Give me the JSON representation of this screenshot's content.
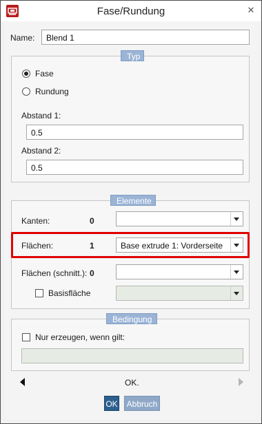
{
  "window": {
    "title": "Fase/Rundung",
    "close_glyph": "✕",
    "app_icon": "fillet-tool-icon",
    "accent_color": "#b71c1c"
  },
  "name_field": {
    "label": "Name:",
    "value": "Blend 1"
  },
  "typ_group": {
    "legend": "Typ",
    "options": [
      {
        "label": "Fase",
        "selected": true
      },
      {
        "label": "Rundung",
        "selected": false
      }
    ],
    "abstand1": {
      "label": "Abstand 1:",
      "value": "0.5"
    },
    "abstand2": {
      "label": "Abstand 2:",
      "value": "0.5"
    }
  },
  "elemente_group": {
    "legend": "Elemente",
    "kanten": {
      "label": "Kanten:",
      "count": "0",
      "value": ""
    },
    "flaechen": {
      "label": "Flächen:",
      "count": "1",
      "value": "Base extrude 1: Vorderseite",
      "highlight_color": "#e00000"
    },
    "flaechen_schnitt": {
      "label": "Flächen (schnitt.):",
      "count": "0",
      "value": ""
    },
    "basisflaeche": {
      "label": "Basisfläche",
      "checked": false,
      "value": ""
    }
  },
  "bedingung_group": {
    "legend": "Bedingung",
    "checkbox_label": "Nur erzeugen, wenn gilt:",
    "checked": false,
    "condition_value": ""
  },
  "status": {
    "text": "OK."
  },
  "buttons": {
    "ok": "OK",
    "cancel": "Abbruch"
  }
}
